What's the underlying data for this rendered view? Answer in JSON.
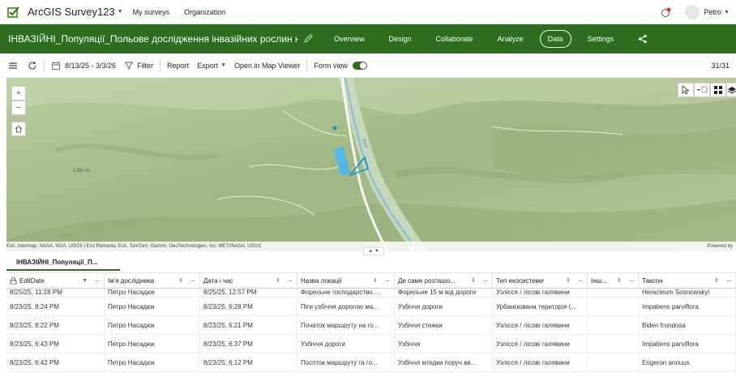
{
  "topbar": {
    "app_title": "ArcGIS Survey123",
    "nav": [
      "My surveys",
      "Organization"
    ],
    "username": "Petro"
  },
  "survey": {
    "title": "ІНВАЗІЙНІ_Популяції_Польове дослідження інвазійних рослин н...",
    "tabs": [
      "Overview",
      "Design",
      "Collaborate",
      "Analyze",
      "Data",
      "Settings"
    ],
    "active_tab": "Data",
    "accent_color": "#2c6d1e"
  },
  "toolbar": {
    "date_range": "8/13/25 - 3/3/26",
    "filter_label": "Filter",
    "report_label": "Report",
    "export_label": "Export",
    "map_viewer_label": "Open in Map Viewer",
    "form_view_label": "Form view",
    "form_view_on": true,
    "record_count": "31/31"
  },
  "map": {
    "elevation_label": "1260 m",
    "river_label": "Prut",
    "attribution": "Esri, Intermap, NASA, NGA, USGS | Esri Romania, Esri, TomTom, Garmin, GeoTechnologies, Inc, METI/NASA, USGS",
    "powered_by": "Powered by"
  },
  "layer_tab": "ІНВАЗІЙНІ_Популяції_П...",
  "table": {
    "columns": [
      "EditDate",
      "Ім'я дослідника",
      "Дата і час",
      "Назва локації",
      "Де саме розташо...",
      "Тип екосистеми",
      "Інш...",
      "Таксон"
    ],
    "rows": [
      [
        "8/25/25, 11:28 PM",
        "Петро Насадюк",
        "8/25/25, 12:57 PM",
        "Форельне господарство ...",
        "Форельне 15 м від дороги",
        "Узлісся / лісові галявини",
        "",
        "Heracleum Sosnowskyi"
      ],
      [
        "8/23/25, 8:24 PM",
        "Петро Насадюк",
        "8/23/25, 6:28 PM",
        "Піги узбіччя дорогою ма...",
        "Узбіччя дороги",
        "Урбанізована територія (...",
        "",
        "Impatiens parviflora"
      ],
      [
        "8/23/25, 8:22 PM",
        "Петро Насадюк",
        "8/23/25, 6:21 PM",
        "Початок маршруту на го...",
        "Узбіччя стежки",
        "Узлісся / лісові галявини",
        "",
        "Biden frondosa"
      ],
      [
        "8/23/25, 6:43 PM",
        "Петро Насадюк",
        "8/23/25, 6:37 PM",
        "Узбіччя дороги",
        "Узбіччя",
        "Узлісся / лісові галявини",
        "",
        "Impatiens parviflora"
      ],
      [
        "8/23/25, 6:42 PM",
        "Петро Насадюк",
        "8/23/25, 6:12 PM",
        "Поспток маршруту га го...",
        "Узбіччя мтедки поруч вв...",
        "Узлісся / лісові галявини",
        "",
        "Erigeron annuus"
      ]
    ]
  }
}
